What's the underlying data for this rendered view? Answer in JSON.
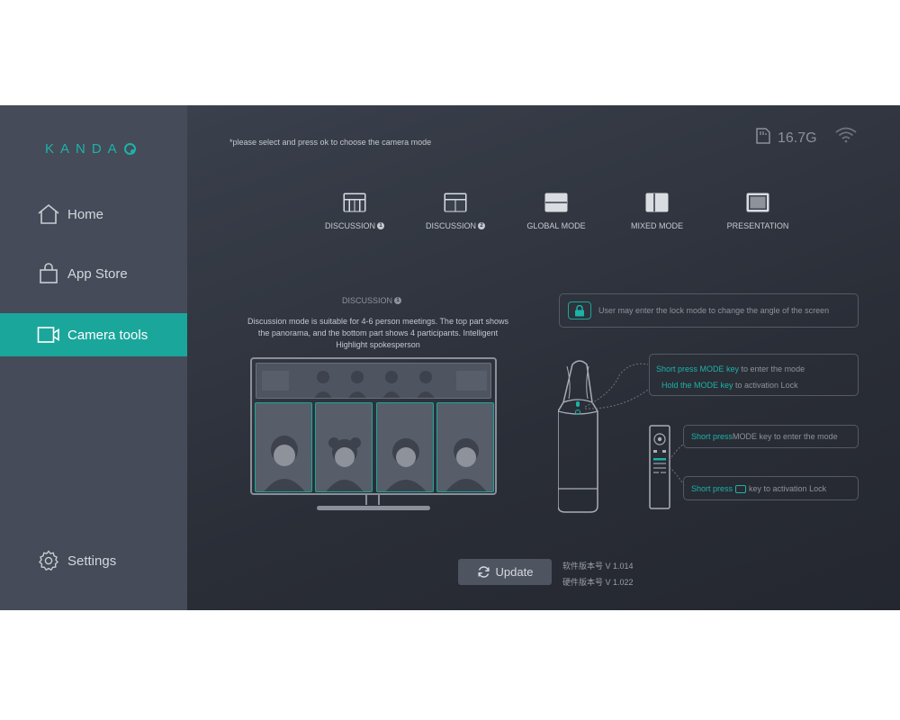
{
  "brand": {
    "logo_text": "KANDA",
    "accent": "#1cb3a8"
  },
  "sidebar": {
    "items": [
      {
        "label": "Home",
        "icon": "home-icon",
        "active": false
      },
      {
        "label": "App Store",
        "icon": "shopping-bag-icon",
        "active": false
      },
      {
        "label": "Camera tools",
        "icon": "video-camera-icon",
        "active": true
      },
      {
        "label": "Settings",
        "icon": "gear-icon",
        "active": false
      }
    ]
  },
  "header": {
    "hint": "*please select and press ok to choose the camera mode",
    "storage": "16.7G",
    "storage_icon": "sd-card-icon",
    "wifi_icon": "wifi-icon"
  },
  "modes": [
    {
      "label": "DISCUSSION",
      "badge": "1",
      "icon": "discussion-1-mode-icon"
    },
    {
      "label": "DISCUSSION",
      "badge": "2",
      "icon": "discussion-2-mode-icon"
    },
    {
      "label": "GLOBAL MODE",
      "badge": "",
      "icon": "global-mode-icon"
    },
    {
      "label": "MIXED MODE",
      "badge": "",
      "icon": "mixed-mode-icon"
    },
    {
      "label": "PRESENTATION",
      "badge": "",
      "icon": "presentation-mode-icon"
    }
  ],
  "detail": {
    "title": "DISCUSSION",
    "badge": "1",
    "description": "Discussion mode is suitable for 4-6 person meetings. The top part shows the panorama, and the bottom part shows 4 participants. Intelligent Highlight spokesperson"
  },
  "callouts": {
    "lock": "User may enter the lock mode to change the angle of the screen",
    "camera_line1_teal": "Short press MODE key",
    "camera_line1_rest": " to enter the mode",
    "camera_line2_teal": "Hold the MODE key",
    "camera_line2_rest": " to activation Lock",
    "remote1_teal": "Short press",
    "remote1_rest": " MODE key to enter the mode",
    "remote2_teal": "Short press",
    "remote2_rest": " key to activation Lock"
  },
  "footer": {
    "update_label": "Update",
    "software_version": "软件版本号  V 1.014",
    "hardware_version": "硬件版本号  V 1.022"
  }
}
